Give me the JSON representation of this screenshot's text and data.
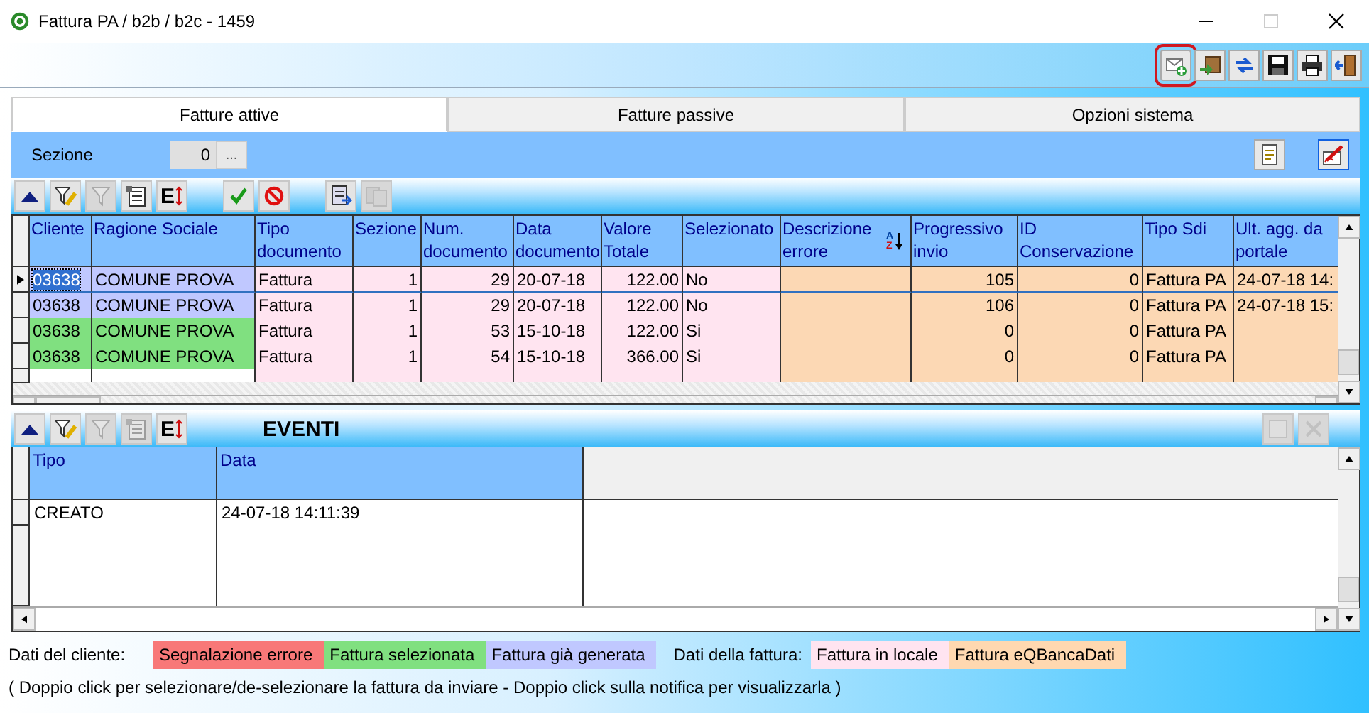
{
  "window": {
    "title": "Fattura PA / b2b / b2c - 1459",
    "controls": [
      {
        "kind": "minimize",
        "disabled": false
      },
      {
        "kind": "maximize",
        "disabled": true
      },
      {
        "kind": "close",
        "disabled": false
      }
    ]
  },
  "toolbar": [
    {
      "kind": "mail-add",
      "highlighted": true
    },
    {
      "kind": "arrow-box",
      "highlighted": false
    },
    {
      "kind": "sync",
      "highlighted": false
    },
    {
      "kind": "save",
      "highlighted": false
    },
    {
      "kind": "print",
      "highlighted": false
    },
    {
      "kind": "exit",
      "highlighted": false
    }
  ],
  "tabs": [
    {
      "label": "Fatture attive",
      "selected": true
    },
    {
      "label": "Fatture passive",
      "selected": false
    },
    {
      "label": "Opzioni sistema",
      "selected": false
    }
  ],
  "section": {
    "label": "Sezione",
    "value": "0",
    "button": "..."
  },
  "section_tools": [
    {
      "kind": "note",
      "focused": false
    },
    {
      "kind": "sign",
      "focused": true
    }
  ],
  "grid": {
    "toolbar": [
      [
        {
          "kind": "up",
          "disabled": false
        },
        {
          "kind": "filter-edit",
          "disabled": false
        },
        {
          "kind": "filter",
          "disabled": true
        },
        {
          "kind": "list",
          "disabled": false
        },
        {
          "kind": "sort",
          "label": "E",
          "disabled": false
        }
      ],
      [
        {
          "kind": "check",
          "disabled": false
        },
        {
          "kind": "block",
          "disabled": false
        }
      ],
      [
        {
          "kind": "export",
          "disabled": false
        },
        {
          "kind": "copy",
          "disabled": true
        }
      ]
    ],
    "columns": [
      {
        "label": "Cliente",
        "kind": "client",
        "numeric": false
      },
      {
        "label": "Ragione Sociale",
        "kind": "client",
        "numeric": false
      },
      {
        "label": "Tipo documento",
        "kind": "local",
        "numeric": false
      },
      {
        "label": "Sezione",
        "kind": "local",
        "numeric": true
      },
      {
        "label": "Num. documento",
        "kind": "local",
        "numeric": true
      },
      {
        "label": "Data documento",
        "kind": "local",
        "numeric": false
      },
      {
        "label": "Valore Totale",
        "kind": "local",
        "numeric": true
      },
      {
        "label": "Selezionato",
        "kind": "local",
        "numeric": false
      },
      {
        "label": "Descrizione errore",
        "kind": "bank",
        "numeric": false,
        "sort": {
          "top": "A",
          "bottom": "Z"
        }
      },
      {
        "label": "Progressivo invio",
        "kind": "bank",
        "numeric": true
      },
      {
        "label": "ID Conservazione",
        "kind": "bank",
        "numeric": true
      },
      {
        "label": "Tipo Sdi",
        "kind": "bank",
        "numeric": false
      },
      {
        "label": "Ult. agg. da portale",
        "kind": "bank",
        "numeric": false
      }
    ],
    "rows": [
      {
        "current": true,
        "color": "#c0c8ff",
        "cells": [
          "03638",
          "COMUNE PROVA",
          "Fattura",
          "1",
          "29",
          "20-07-18",
          "122.00",
          "No",
          "",
          "105",
          "0",
          "Fattura PA",
          "24-07-18 14:"
        ]
      },
      {
        "current": false,
        "color": "#c0c8ff",
        "cells": [
          "03638",
          "COMUNE PROVA",
          "Fattura",
          "1",
          "29",
          "20-07-18",
          "122.00",
          "No",
          "",
          "106",
          "0",
          "Fattura PA",
          "24-07-18 15:"
        ]
      },
      {
        "current": false,
        "color": "#80e080",
        "cells": [
          "03638",
          "COMUNE PROVA",
          "Fattura",
          "1",
          "53",
          "15-10-18",
          "122.00",
          "Si",
          "",
          "0",
          "0",
          "Fattura PA",
          ""
        ]
      },
      {
        "current": false,
        "color": "#80e080",
        "cells": [
          "03638",
          "COMUNE PROVA",
          "Fattura",
          "1",
          "54",
          "15-10-18",
          "366.00",
          "Si",
          "",
          "0",
          "0",
          "Fattura PA",
          ""
        ]
      }
    ]
  },
  "events": {
    "title": "EVENTI",
    "toolbar": [
      {
        "kind": "up",
        "disabled": false
      },
      {
        "kind": "filter-edit",
        "disabled": false
      },
      {
        "kind": "filter",
        "disabled": true
      },
      {
        "kind": "list",
        "disabled": true
      },
      {
        "kind": "sort",
        "label": "E",
        "disabled": false
      }
    ],
    "window_buttons": [
      {
        "kind": "window",
        "disabled": true
      },
      {
        "kind": "close",
        "disabled": true
      }
    ],
    "columns": [
      "Tipo",
      "Data"
    ],
    "rows": [
      [
        "CREATO",
        "24-07-18 14:11:39"
      ]
    ]
  },
  "legend": [
    {
      "label": "Dati del cliente:",
      "items": [
        {
          "label": "Segnalazione errore",
          "color": "#f87878"
        },
        {
          "label": "Fattura selezionata",
          "color": "#80e080"
        },
        {
          "label": "Fattura già generata",
          "color": "#c0c8ff"
        }
      ]
    },
    {
      "label": "Dati della fattura:",
      "items": [
        {
          "label": "Fattura in locale",
          "color": "#ffe4f0"
        },
        {
          "label": "Fattura eQBancaDati",
          "color": "#ffd8b0"
        }
      ]
    }
  ],
  "note": "( Doppio click per selezionare/de-selezionare la fattura da inviare - Doppio click sulla notifica per visualizzarla )"
}
